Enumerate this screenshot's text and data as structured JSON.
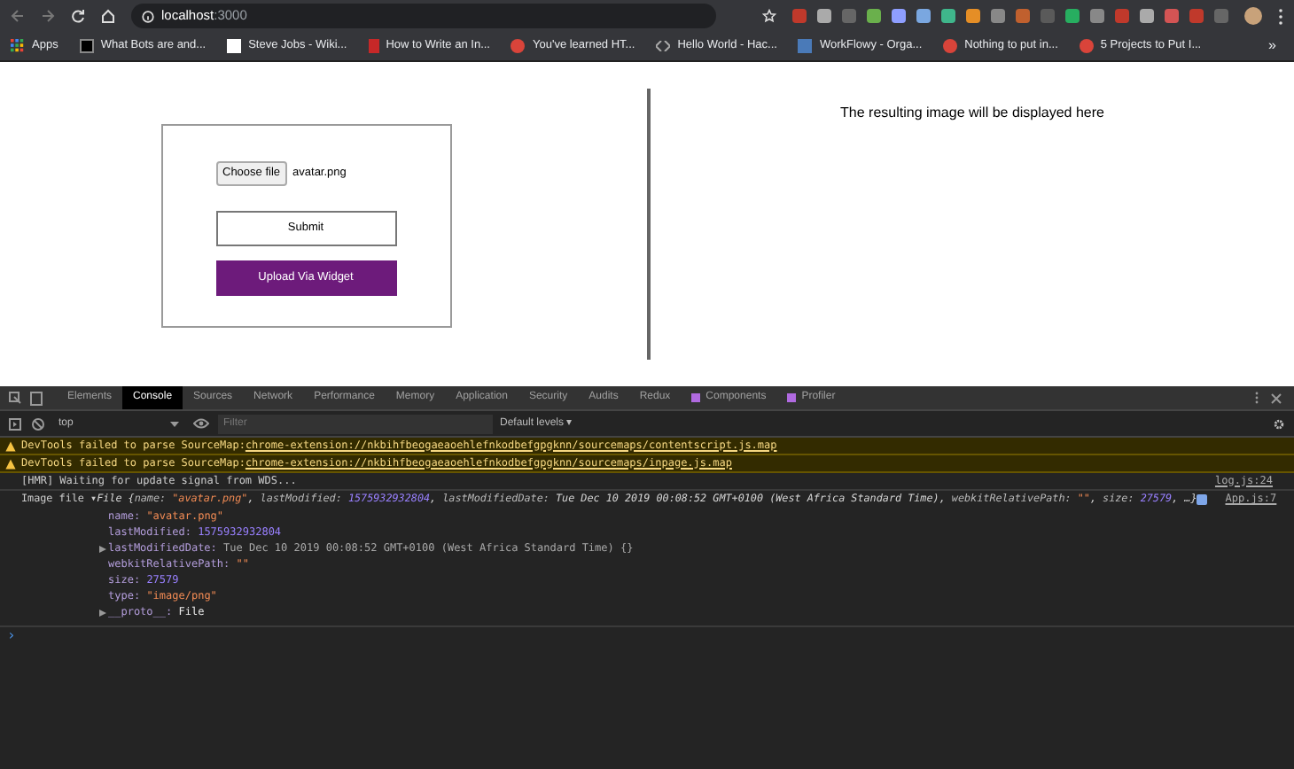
{
  "browser": {
    "address_host": "localhost",
    "address_port": ":3000",
    "bookmarks": [
      {
        "label": "Apps",
        "kind": "apps"
      },
      {
        "label": "What Bots are and...",
        "kind": "m"
      },
      {
        "label": "Steve Jobs - Wiki...",
        "kind": "w"
      },
      {
        "label": "How to Write an In...",
        "kind": "red"
      },
      {
        "label": "You've learned HT...",
        "kind": "round"
      },
      {
        "label": "Hello World - Hac...",
        "kind": "code"
      },
      {
        "label": "WorkFlowy - Orga...",
        "kind": "blue"
      },
      {
        "label": "Nothing to put in...",
        "kind": "round"
      },
      {
        "label": "5 Projects to Put I...",
        "kind": "round"
      }
    ],
    "more_bookmarks": "»"
  },
  "page": {
    "file_button": "Choose file",
    "file_name": "avatar.png",
    "submit": "Submit",
    "widget_button": "Upload Via Widget",
    "result_text": "The resulting image will be displayed here"
  },
  "devtools": {
    "tabs": [
      {
        "label": "Elements",
        "selected": false
      },
      {
        "label": "Console",
        "selected": true
      },
      {
        "label": "Sources",
        "selected": false
      },
      {
        "label": "Network",
        "selected": false
      },
      {
        "label": "Performance",
        "selected": false
      },
      {
        "label": "Memory",
        "selected": false
      },
      {
        "label": "Application",
        "selected": false
      },
      {
        "label": "Security",
        "selected": false
      },
      {
        "label": "Audits",
        "selected": false
      },
      {
        "label": "Redux",
        "selected": false
      },
      {
        "label": "Components",
        "selected": false,
        "kind": "react"
      },
      {
        "label": "Profiler",
        "selected": false,
        "kind": "react"
      }
    ],
    "context": "top",
    "filter_placeholder": "Filter",
    "levels": "Default levels ▾",
    "messages": [
      {
        "kind": "warning",
        "text": "DevTools failed to parse SourceMap: ",
        "link": "chrome-extension://nkbihfbeogaeaoehlefnkodbefgpgknn/sourcemaps/contentscript.js.map"
      },
      {
        "kind": "warning",
        "text": "DevTools failed to parse SourceMap: ",
        "link": "chrome-extension://nkbihfbeogaeaoehlefnkodbefgpgknn/sourcemaps/inpage.js.map"
      },
      {
        "kind": "log",
        "text": "[HMR] Waiting for update signal from WDS...",
        "source": "log.js:24"
      }
    ],
    "object_log": {
      "prefix": "Image file ▾",
      "source": "App.js:7",
      "summary": [
        {
          "kind": "italic",
          "text": "File {"
        },
        {
          "kind": "key",
          "text": "name: "
        },
        {
          "kind": "string",
          "text": "\"avatar.png\""
        },
        {
          "kind": "italic",
          "text": ", "
        },
        {
          "kind": "key",
          "text": "lastModified: "
        },
        {
          "kind": "number",
          "text": "1575932932804"
        },
        {
          "kind": "italic",
          "text": ", "
        },
        {
          "kind": "key",
          "text": "lastModifiedDate: "
        },
        {
          "kind": "italic",
          "text": "Tue Dec 10 2019 00:08:52 GMT+0100 (West Africa Standard Time), "
        },
        {
          "kind": "key",
          "text": "webkitRelativePath: "
        },
        {
          "kind": "string",
          "text": "\"\""
        },
        {
          "kind": "italic",
          "text": ", "
        },
        {
          "kind": "key",
          "text": "size: "
        },
        {
          "kind": "number",
          "text": "27579"
        },
        {
          "kind": "italic",
          "text": ", …}"
        }
      ],
      "properties": [
        {
          "expandable": false,
          "key": "name: ",
          "value": "\"avatar.png\"",
          "kind": "string"
        },
        {
          "expandable": false,
          "key": "lastModified: ",
          "value": "1575932932804",
          "kind": "number"
        },
        {
          "expandable": true,
          "key": "lastModifiedDate: ",
          "value": "Tue Dec 10 2019 00:08:52 GMT+0100 (West Africa Standard Time) {}",
          "kind": "plain"
        },
        {
          "expandable": false,
          "key": "webkitRelativePath: ",
          "value": "\"\"",
          "kind": "string"
        },
        {
          "expandable": false,
          "key": "size: ",
          "value": "27579",
          "kind": "number"
        },
        {
          "expandable": false,
          "key": "type: ",
          "value": "\"image/png\"",
          "kind": "string"
        },
        {
          "expandable": true,
          "key": "__proto__: ",
          "value": "File",
          "kind": "white"
        }
      ]
    },
    "prompt": "›"
  }
}
